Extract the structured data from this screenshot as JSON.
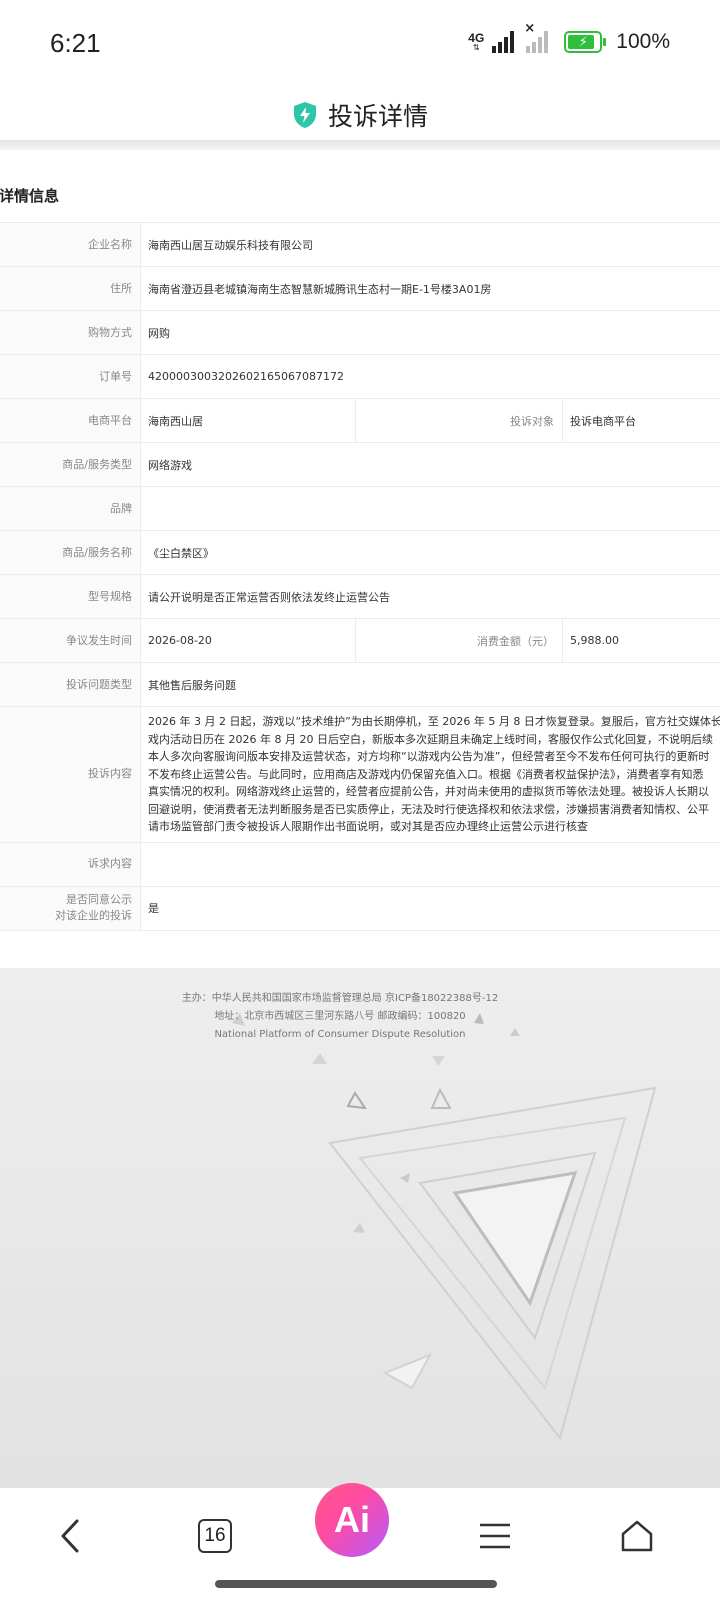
{
  "status_bar": {
    "time": "6:21",
    "network": "4G",
    "battery_percent": "100%"
  },
  "header": {
    "title": "投诉详情",
    "icon": "shield-bolt-icon",
    "accent_color": "#2ec5a8"
  },
  "section_title": "诉详情信息",
  "rows": {
    "company": {
      "label": "企业名称",
      "value": "海南西山居互动娱乐科技有限公司"
    },
    "address": {
      "label": "住所",
      "value": "海南省澄迈县老城镇海南生态智慧新城腾讯生态村一期E-1号楼3A01房"
    },
    "purchase_method": {
      "label": "购物方式",
      "value": "网购"
    },
    "order_no": {
      "label": "订单号",
      "value": "420000300320260216506708717­2"
    },
    "platform": {
      "label": "电商平台",
      "value": "海南西山居",
      "label2": "投诉对象",
      "value2": "投诉电商平台"
    },
    "goods_type": {
      "label": "商品/服务类型",
      "value": "网络游戏"
    },
    "brand": {
      "label": "品牌",
      "value": ""
    },
    "goods_name": {
      "label": "商品/服务名称",
      "value": "《尘白禁区》"
    },
    "model": {
      "label": "型号规格",
      "value": "请公开说明是否正常运营否则依法发终止运营公告"
    },
    "dispute_time": {
      "label": "争议发生时间",
      "value": "2026-08-20",
      "label2": "消费金额（元）",
      "value2": "5,988.00"
    },
    "problem_type": {
      "label": "投诉问题类型",
      "value": "其他售后服务问题"
    },
    "content": {
      "label": "投诉内容",
      "lines": [
        "2026 年 3 月 2 日起，游戏以“技术维护”为由长期停机，至 2026 年 5 月 8 日才恢复登录。复服后，官方社交媒体长",
        "戏内活动日历在 2026 年 8 月 20 日后空白，新版本多次延期且未确定上线时间，客服仅作公式化回复，不说明后续",
        "本人多次向客服询问版本安排及运营状态，对方均称“以游戏内公告为准”，但经营者至今不发布任何可执行的更新时",
        "不发布终止运营公告。与此同时，应用商店及游戏内仍保留充值入口。根据《消费者权益保护法》，消费者享有知悉",
        "真实情况的权利。网络游戏终止运营的，经营者应提前公告，并对尚未使用的虚拟货币等依法处理。被投诉人长期以",
        "回避说明，使消费者无法判断服务是否已实质停止，无法及时行使选择权和依法求偿，涉嫌损害消费者知情权、公平",
        "请市场监管部门责令被投诉人限期作出书面说明，或对其是否应办理终止运营公示进行核查"
      ]
    },
    "demand": {
      "label": "诉求内容",
      "value": ""
    },
    "publish_consent": {
      "label_line1": "是否同意公示",
      "label_line2": "对该企业的投诉",
      "value": "是"
    }
  },
  "footer": {
    "line1": "主办：中华人民共和国国家市场监督管理总局 京ICP备18022388号-12",
    "line2": "地址：北京市西城区三里河东路八号 邮政编码：100820",
    "line3": "National Platform of Consumer Dispute Resolution"
  },
  "bottom_nav": {
    "back_icon": "chevron-left-icon",
    "tab_count": "16",
    "ai_label": "Ai",
    "menu_icon": "hamburger-menu-icon",
    "home_icon": "home-icon"
  }
}
